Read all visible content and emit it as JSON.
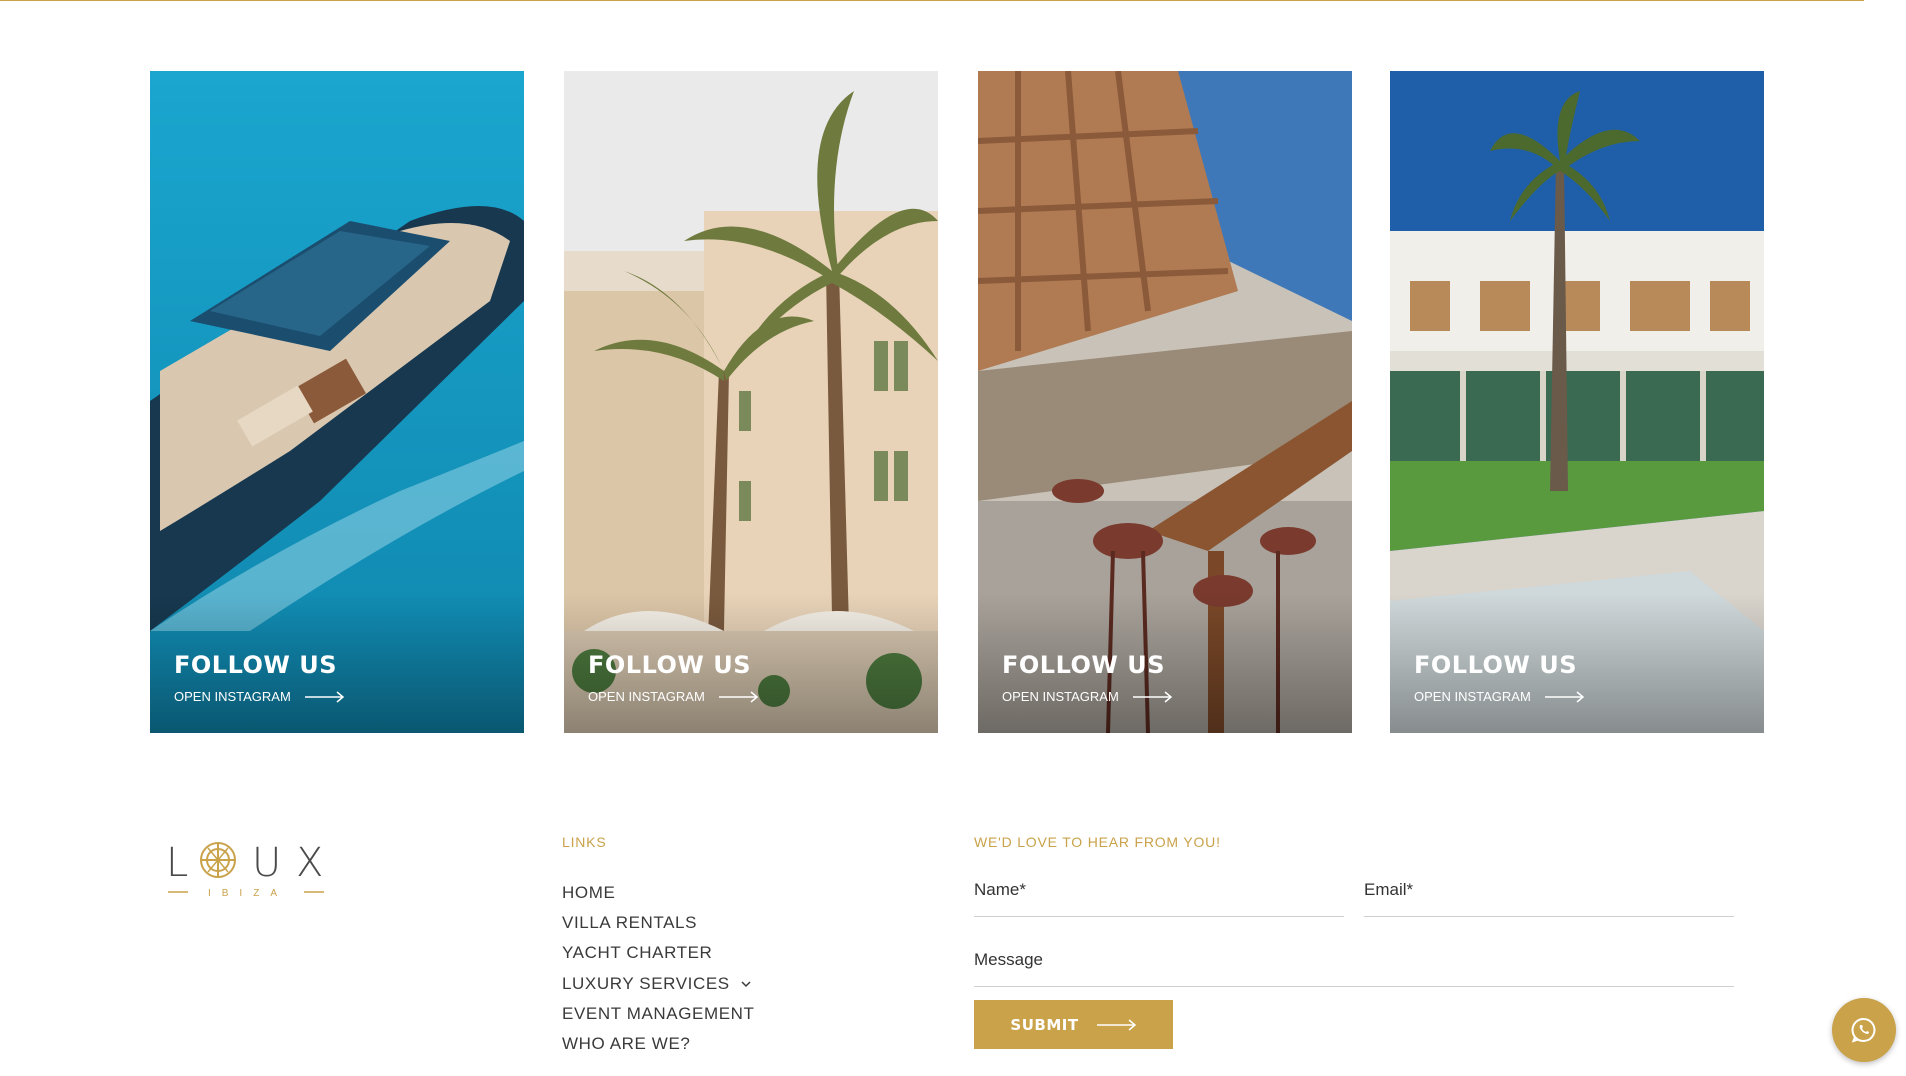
{
  "colors": {
    "accent": "#c9a24a",
    "text": "#333333",
    "white": "#ffffff"
  },
  "cards": [
    {
      "title": "FOLLOW US",
      "cta": "OPEN INSTAGRAM",
      "scene": "yacht on turquoise sea",
      "arrow_icon": "long-arrow-right-icon"
    },
    {
      "title": "FOLLOW US",
      "cta": "OPEN INSTAGRAM",
      "scene": "palm trees and old town buildings",
      "arrow_icon": "long-arrow-right-icon"
    },
    {
      "title": "FOLLOW US",
      "cta": "OPEN INSTAGRAM",
      "scene": "wooden restaurant terrace",
      "arrow_icon": "long-arrow-right-icon"
    },
    {
      "title": "FOLLOW US",
      "cta": "OPEN INSTAGRAM",
      "scene": "villa with palm tree and pool",
      "arrow_icon": "long-arrow-right-icon"
    }
  ],
  "footer": {
    "logo": {
      "letters": [
        "L",
        "U",
        "X"
      ],
      "subtitle": "IBIZA"
    },
    "links_heading": "LINKS",
    "links": [
      {
        "label": "HOME"
      },
      {
        "label": "VILLA RENTALS"
      },
      {
        "label": "YACHT CHARTER"
      },
      {
        "label": "LUXURY SERVICES",
        "icon": "chevron-down-icon"
      },
      {
        "label": "EVENT MANAGEMENT"
      },
      {
        "label": "WHO ARE WE?"
      }
    ],
    "contact_heading": "WE'D LOVE TO HEAR FROM YOU!",
    "form": {
      "name_placeholder": "Name*",
      "email_placeholder": "Email*",
      "message_placeholder": "Message",
      "submit_label": "SUBMIT"
    }
  },
  "floating_button": {
    "icon": "whatsapp-icon"
  }
}
